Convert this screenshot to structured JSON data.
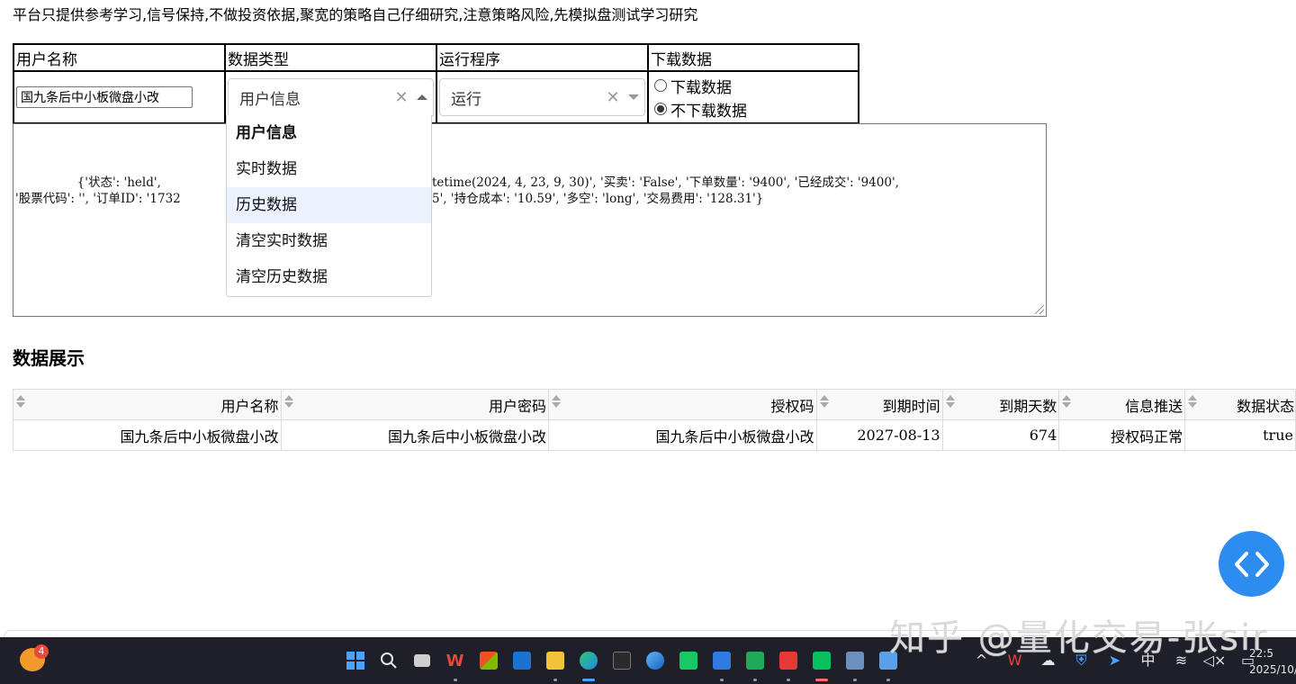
{
  "notice": "平台只提供参考学习,信号保持,不做投资依据,聚宽的策略自己仔细研究,注意策略风险,先模拟盘测试学习研究",
  "controls": {
    "headers": [
      "用户名称",
      "数据类型",
      "运行程序",
      "下载数据"
    ],
    "user_name_value": "国九条后中小板微盘小改",
    "data_type": {
      "selected": "用户信息",
      "options": [
        "用户信息",
        "实时数据",
        "历史数据",
        "清空实时数据",
        "清空历史数据"
      ],
      "highlighted_index": 2
    },
    "run_program": {
      "selected": "运行"
    },
    "download": {
      "options": [
        "下载数据",
        "不下载数据"
      ],
      "checked_index": 1
    }
  },
  "log_text": {
    "line1_left": "                {'状态': 'held',",
    "line1_right": "tetime(2024, 4, 23, 9, 30)', '买卖': 'False', '下单数量': '9400', '已经成交': '9400',",
    "line2_left": "'股票代码': '', '订单ID': '1732",
    "line2_right": "5', '持仓成本': '10.59', '多空': 'long', '交易费用': '128.31'}"
  },
  "section_title": "数据展示",
  "table": {
    "columns": [
      "用户名称",
      "用户密码",
      "授权码",
      "到期时间",
      "到期天数",
      "信息推送",
      "数据状态"
    ],
    "rows": [
      [
        "国九条后中小板微盘小改",
        "国九条后中小板微盘小改",
        "国九条后中小板微盘小改",
        "2027-08-13",
        "674",
        "授权码正常",
        "true"
      ]
    ]
  },
  "watermark": "知乎 @量化交易-张sir",
  "taskbar": {
    "notification_count": "4",
    "tray_ime": "中",
    "clock_time": "22:5",
    "clock_date": "2025/10/"
  },
  "colors": {
    "accent": "#2d8cf0",
    "dropdown_hover": "#ebf2fe",
    "taskbar": "#1f1f2a"
  }
}
